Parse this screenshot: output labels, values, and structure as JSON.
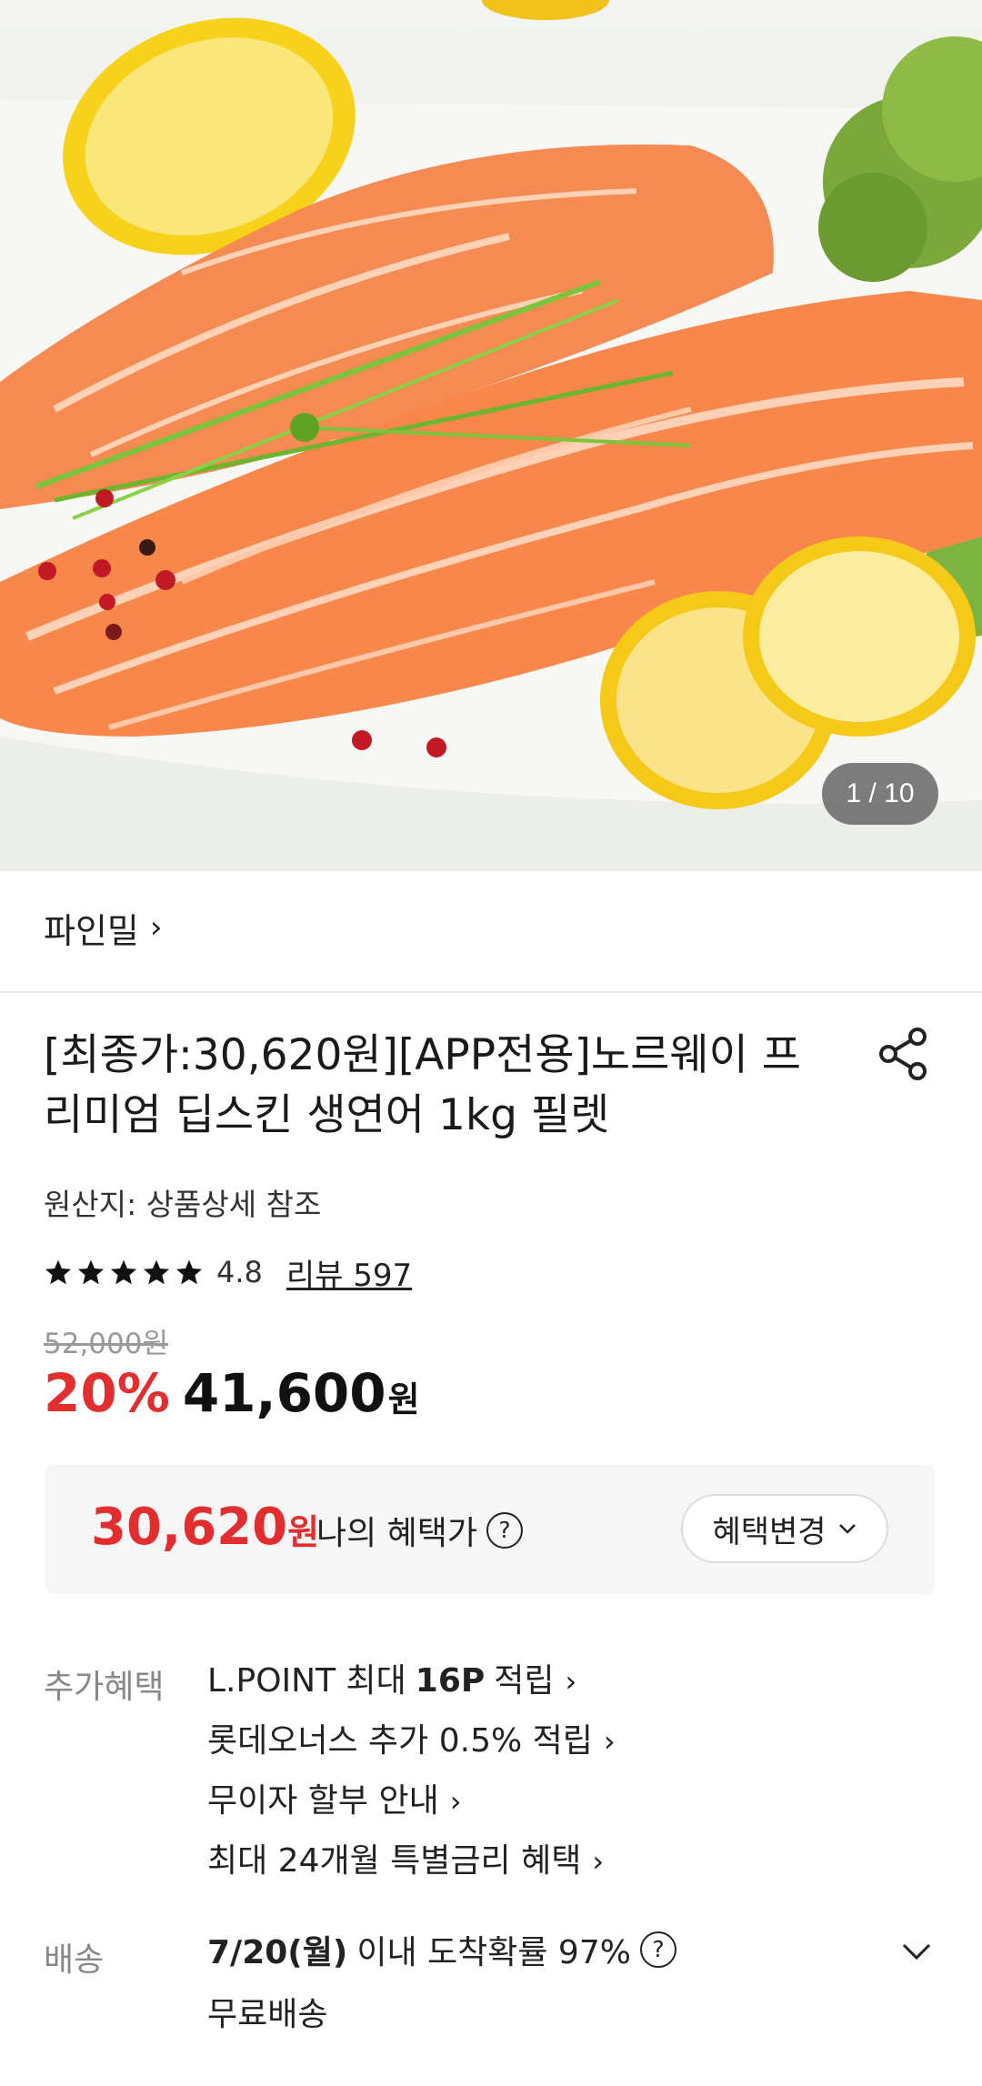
{
  "gallery": {
    "current": "1",
    "total": "10",
    "counter_text": "1 / 10"
  },
  "seller": {
    "name": "파인밀"
  },
  "product": {
    "title": "[최종가:30,620원][APP전용]노르웨이 프리미엄 딥스킨 생연어 1kg 필렛",
    "origin": "원산지: 상품상세 참조",
    "rating": 4.8,
    "rating_text": "4.8",
    "review_label": "리뷰 597",
    "original_price": "52,000원",
    "discount": "20%",
    "sale_price": "41,600",
    "currency": "원"
  },
  "benefit_price": {
    "amount": "30,620",
    "currency": "원",
    "label": "나의 혜택가",
    "help_icon": "question-circle-icon",
    "change_button": "혜택변경"
  },
  "extra_benefits": {
    "label": "추가혜택",
    "items": [
      {
        "pre": "L.POINT 최대",
        "bold": "16P",
        "post": "적립"
      },
      {
        "pre": "롯데오너스 추가 0.5% 적립",
        "bold": "",
        "post": ""
      },
      {
        "pre": "무이자 할부 안내",
        "bold": "",
        "post": ""
      },
      {
        "pre": "최대 24개월 특별금리 혜택",
        "bold": "",
        "post": ""
      }
    ]
  },
  "shipping": {
    "label": "배송",
    "date": "7/20(월)",
    "probability_text": "이내 도착확률 97%",
    "free": "무료배송"
  },
  "colors": {
    "accent_red": "#e22e2e",
    "text": "#111111",
    "muted": "#888888",
    "box_bg": "#f6f6f6"
  }
}
